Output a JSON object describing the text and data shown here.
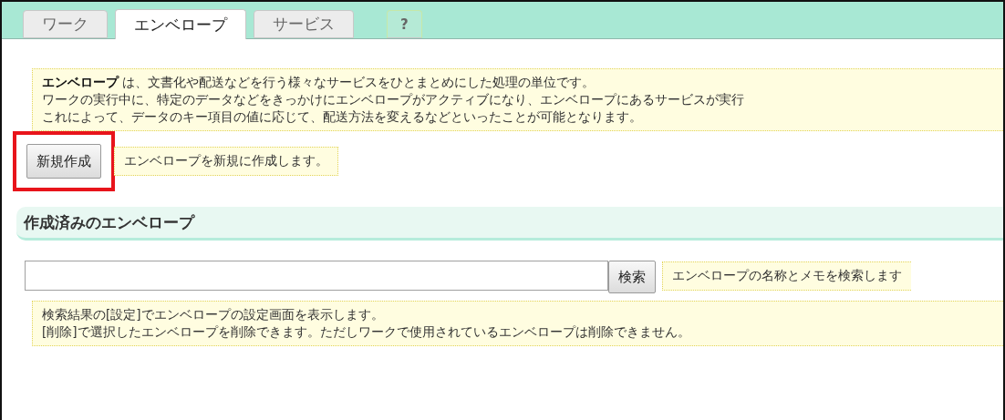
{
  "tabs": [
    {
      "label": "ワーク",
      "selected": false
    },
    {
      "label": "エンベロープ",
      "selected": true
    },
    {
      "label": "サービス",
      "selected": false
    },
    {
      "label": "?",
      "selected": false,
      "kind": "help"
    }
  ],
  "intro": {
    "lines": [
      "**エンベロープ** は、文書化や配送などを行う様々なサービスをひとまとめにした処理の単位です。",
      "ワークの実行中に、特定のデータなどをきっかけにエンベロープがアクティブになり、エンベロープにあるサービスが実行",
      "これによって、データのキー項目の値に応じて、配送方法を変えるなどといったことが可能となります。"
    ]
  },
  "create": {
    "button": "新規作成",
    "highlighted": true,
    "hint": "エンベロープを新規に作成します。"
  },
  "section": {
    "title": "作成済みのエンベロープ"
  },
  "search": {
    "button": "検索",
    "hint": "エンベロープの名称とメモを検索します"
  },
  "notes": {
    "lines": [
      "検索結果の[設定]でエンベロープの設定画面を表示します。",
      "[削除]で選択したエンベロープを削除できます。ただしワークで使用されているエンベロープは削除できません。"
    ]
  }
}
